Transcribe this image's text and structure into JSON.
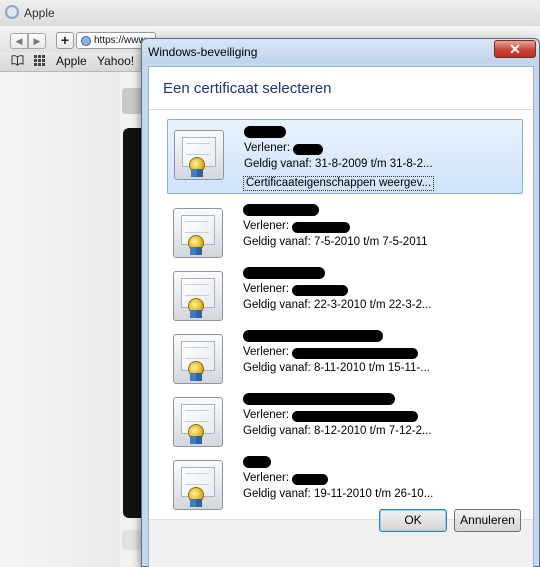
{
  "browser": {
    "title": "Apple",
    "url": "https://www",
    "bookmarks": [
      "Apple",
      "Yahoo!"
    ]
  },
  "dialog": {
    "window_title": "Windows-beveiliging",
    "heading": "Een certificaat selecteren",
    "ok_label": "OK",
    "cancel_label": "Annuleren",
    "close_glyph": "✕",
    "certificates": [
      {
        "issuer_label": "Verlener:",
        "validity": "Geldig vanaf: 31-8-2009 t/m 31-8-2...",
        "selected": true,
        "properties_link": "Certificaateigenschappen weergev..."
      },
      {
        "issuer_label": "Verlener:",
        "validity": "Geldig vanaf: 7-5-2010 t/m 7-5-2011",
        "selected": false
      },
      {
        "issuer_label": "Verlener:",
        "validity": "Geldig vanaf: 22-3-2010 t/m 22-3-2...",
        "selected": false
      },
      {
        "issuer_label": "Verlener:",
        "validity": "Geldig vanaf: 8-11-2010 t/m 15-11-...",
        "selected": false
      },
      {
        "issuer_label": "Verlener:",
        "validity": "Geldig vanaf: 8-12-2010 t/m 7-12-2...",
        "selected": false
      },
      {
        "issuer_label": "Verlener:",
        "validity": "Geldig vanaf: 19-11-2010 t/m 26-10...",
        "selected": false
      }
    ]
  },
  "icons": {
    "browser_app": "apple-app-icon",
    "certificate": "certificate-icon",
    "close": "close-icon"
  },
  "colors": {
    "heading": "#1e3287",
    "selection": "#cfe3fa",
    "close_button": "#c9473b"
  }
}
